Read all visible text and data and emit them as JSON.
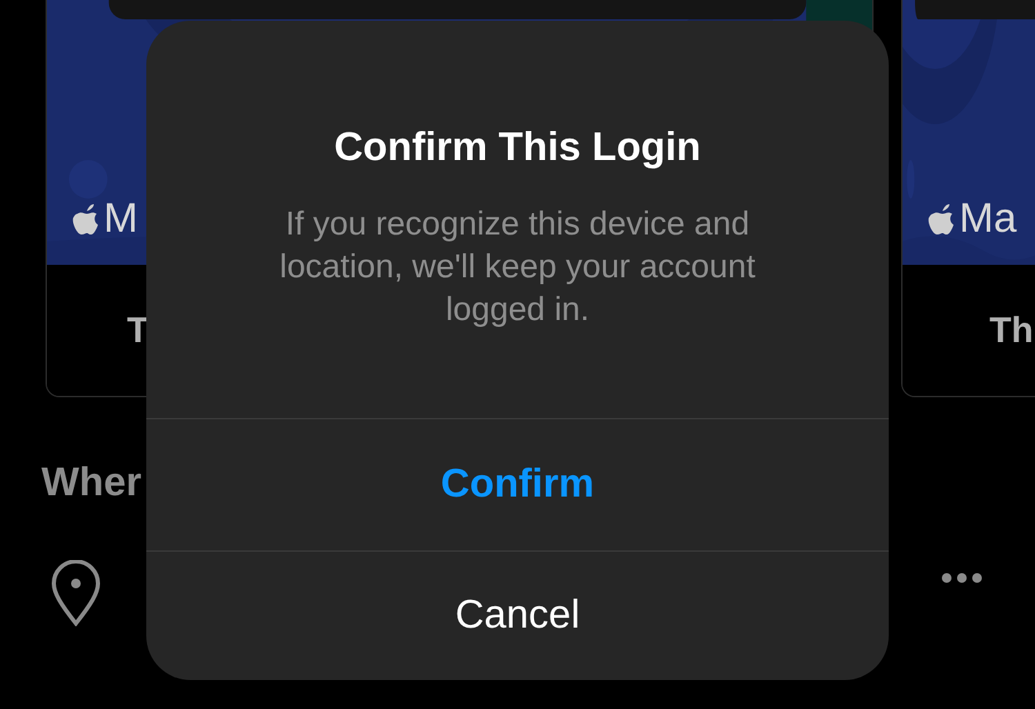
{
  "background": {
    "cards": [
      {
        "map_label": "M",
        "caption": "T"
      },
      {
        "map_label": "Ma",
        "caption": "Th"
      }
    ],
    "section_heading": "Wher"
  },
  "dialog": {
    "title": "Confirm This Login",
    "message": "If you recognize this device and location, we'll keep your account logged in.",
    "buttons": [
      {
        "label": "Confirm",
        "kind": "primary"
      },
      {
        "label": "Cancel",
        "kind": "cancel"
      }
    ]
  }
}
